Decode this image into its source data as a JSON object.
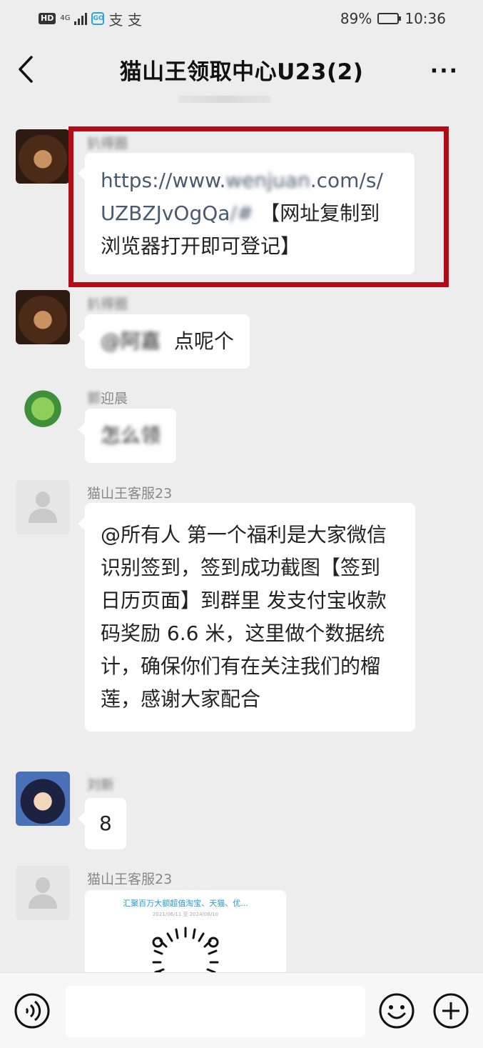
{
  "status_bar": {
    "network_badge": "HD",
    "network_type": "4G",
    "app_icon_text": "GO",
    "notif_glyphs": "支 支",
    "battery": "89%",
    "battery_level": 0.89,
    "time": "10:36"
  },
  "header": {
    "title": "猫山王领取中心U23(2)"
  },
  "messages": [
    {
      "sender": "扒得圈",
      "link_start": "https://www.",
      "link_blur": "wenjuan",
      "link_end": ".com/s/",
      "link_code": "UZBZJvOgQa",
      "link_code_blur": "/#",
      "text_after_link": "【网址复制到浏览器打开即可登记】"
    },
    {
      "sender": "扒得圈",
      "mention_blur": "@阿嘉",
      "text": "点呢个"
    },
    {
      "sender_blur": "郭",
      "sender": "迎晨",
      "text_blur": "怎么领"
    },
    {
      "sender": "猫山王客服23",
      "text": "@所有人 第一个福利是大家微信识别签到，签到成功截图【签到日历页面】到群里 发支付宝收款码奖励 6.6 米，这里做个数据统计，确保你们有在关注我们的榴莲，感谢大家配合"
    },
    {
      "sender_blur": "刘新",
      "text": "8"
    },
    {
      "sender": "猫山王客服23",
      "card_title": "汇聚百万大额超值淘宝、天猫、优...",
      "card_date": "2021/06/11 至 2024/06/10"
    }
  ],
  "input_bar": {
    "placeholder": ""
  }
}
